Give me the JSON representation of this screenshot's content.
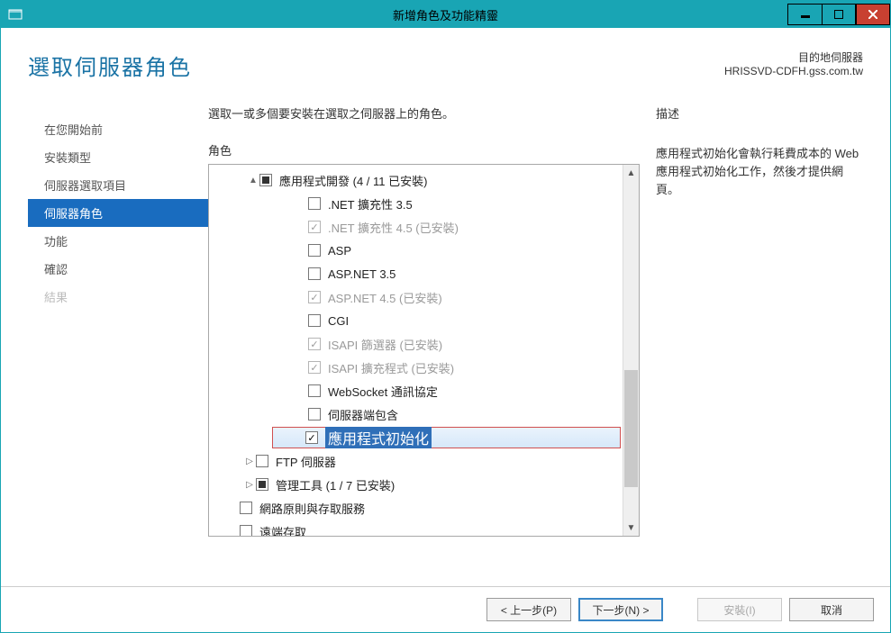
{
  "window": {
    "title": "新增角色及功能精靈"
  },
  "header": {
    "pageTitle": "選取伺服器角色",
    "destinationLabel": "目的地伺服器",
    "destinationServer": "HRISSVD-CDFH.gss.com.tw"
  },
  "sidebar": {
    "items": [
      {
        "label": "在您開始前"
      },
      {
        "label": "安裝類型"
      },
      {
        "label": "伺服器選取項目"
      },
      {
        "label": "伺服器角色",
        "selected": true
      },
      {
        "label": "功能"
      },
      {
        "label": "確認"
      },
      {
        "label": "結果",
        "disabled": true
      }
    ]
  },
  "main": {
    "instruction": "選取一或多個要安裝在選取之伺服器上的角色。",
    "rolesLabel": "角色",
    "descLabel": "描述",
    "desc": "應用程式初始化會執行耗費成本的 Web 應用程式初始化工作，然後才提供網頁。",
    "tree": {
      "parent": "應用程式開發 (4 / 11 已安裝)",
      "children": [
        {
          "label": ".NET 擴充性 3.5",
          "state": "unchecked"
        },
        {
          "label": ".NET 擴充性 4.5 (已安裝)",
          "state": "checked-disabled"
        },
        {
          "label": "ASP",
          "state": "unchecked"
        },
        {
          "label": "ASP.NET 3.5",
          "state": "unchecked"
        },
        {
          "label": "ASP.NET 4.5 (已安裝)",
          "state": "checked-disabled"
        },
        {
          "label": "CGI",
          "state": "unchecked"
        },
        {
          "label": "ISAPI 篩選器 (已安裝)",
          "state": "checked-disabled"
        },
        {
          "label": "ISAPI 擴充程式 (已安裝)",
          "state": "checked-disabled"
        },
        {
          "label": "WebSocket 通訊協定",
          "state": "unchecked"
        },
        {
          "label": "伺服器端包含",
          "state": "unchecked"
        }
      ],
      "highlighted": {
        "label": "應用程式初始化"
      },
      "siblingsAfter": [
        {
          "label": "FTP 伺服器",
          "state": "unchecked",
          "expander": "▷"
        },
        {
          "label": "管理工具 (1 / 7 已安裝)",
          "state": "tri",
          "expander": "▷"
        }
      ],
      "topLevelAfter": [
        {
          "label": "網路原則與存取服務",
          "state": "unchecked"
        },
        {
          "label": "遠端存取",
          "state": "unchecked"
        }
      ]
    }
  },
  "footer": {
    "prev": "< 上一步(P)",
    "next": "下一步(N) >",
    "install": "安裝(I)",
    "cancel": "取消"
  }
}
